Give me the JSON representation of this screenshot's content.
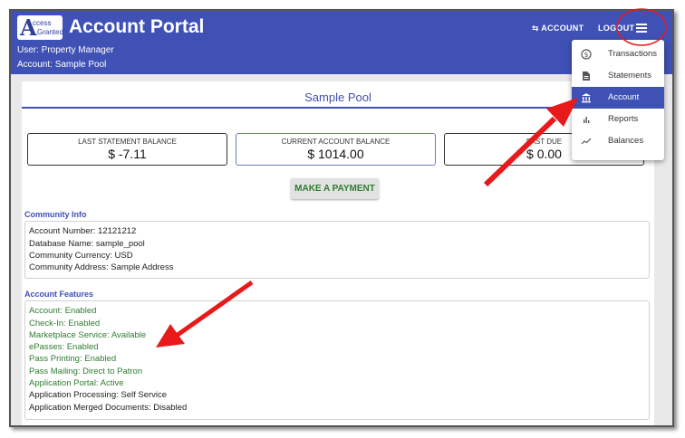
{
  "appbar": {
    "logo_big": "A",
    "logo_line1": "ccess",
    "logo_line2": "Granted",
    "title": "Account Portal",
    "user_line": "User: Property Manager",
    "account_line": "Account: Sample Pool",
    "account_button": "⇆ ACCOUNT",
    "logout_button": "LOGOUT"
  },
  "page": {
    "title": "Sample Pool"
  },
  "balances": [
    {
      "label": "LAST STATEMENT BALANCE",
      "value": "$ -7.11"
    },
    {
      "label": "CURRENT ACCOUNT BALANCE",
      "value": "$ 1014.00"
    },
    {
      "label": "PAST DUE",
      "value": "$ 0.00"
    }
  ],
  "pay_button": "MAKE A PAYMENT",
  "community_info": {
    "heading": "Community Info",
    "rows": [
      "Account Number: 12121212",
      "Database Name: sample_pool",
      "Community Currency: USD",
      "Community Address: Sample Address"
    ]
  },
  "account_features": {
    "heading": "Account Features",
    "rows": [
      "Account: Enabled",
      "Check-In: Enabled",
      "Marketplace Service: Available",
      "ePasses: Enabled",
      "Pass Printing: Enabled",
      "Pass Mailing: Direct to Patron",
      "Application Portal: Active",
      "Application Processing: Self Service",
      "Application Merged Documents: Disabled"
    ]
  },
  "menu": {
    "items": [
      {
        "label": "Transactions",
        "icon": "dollar-circle-icon"
      },
      {
        "label": "Statements",
        "icon": "document-icon"
      },
      {
        "label": "Account",
        "icon": "bank-icon",
        "active": true
      },
      {
        "label": "Reports",
        "icon": "bar-chart-icon"
      },
      {
        "label": "Balances",
        "icon": "trend-line-icon"
      }
    ]
  },
  "colors": {
    "primary": "#3f51b5",
    "enabled_green": "#2e7d32",
    "annotation_red": "#e8191b"
  }
}
